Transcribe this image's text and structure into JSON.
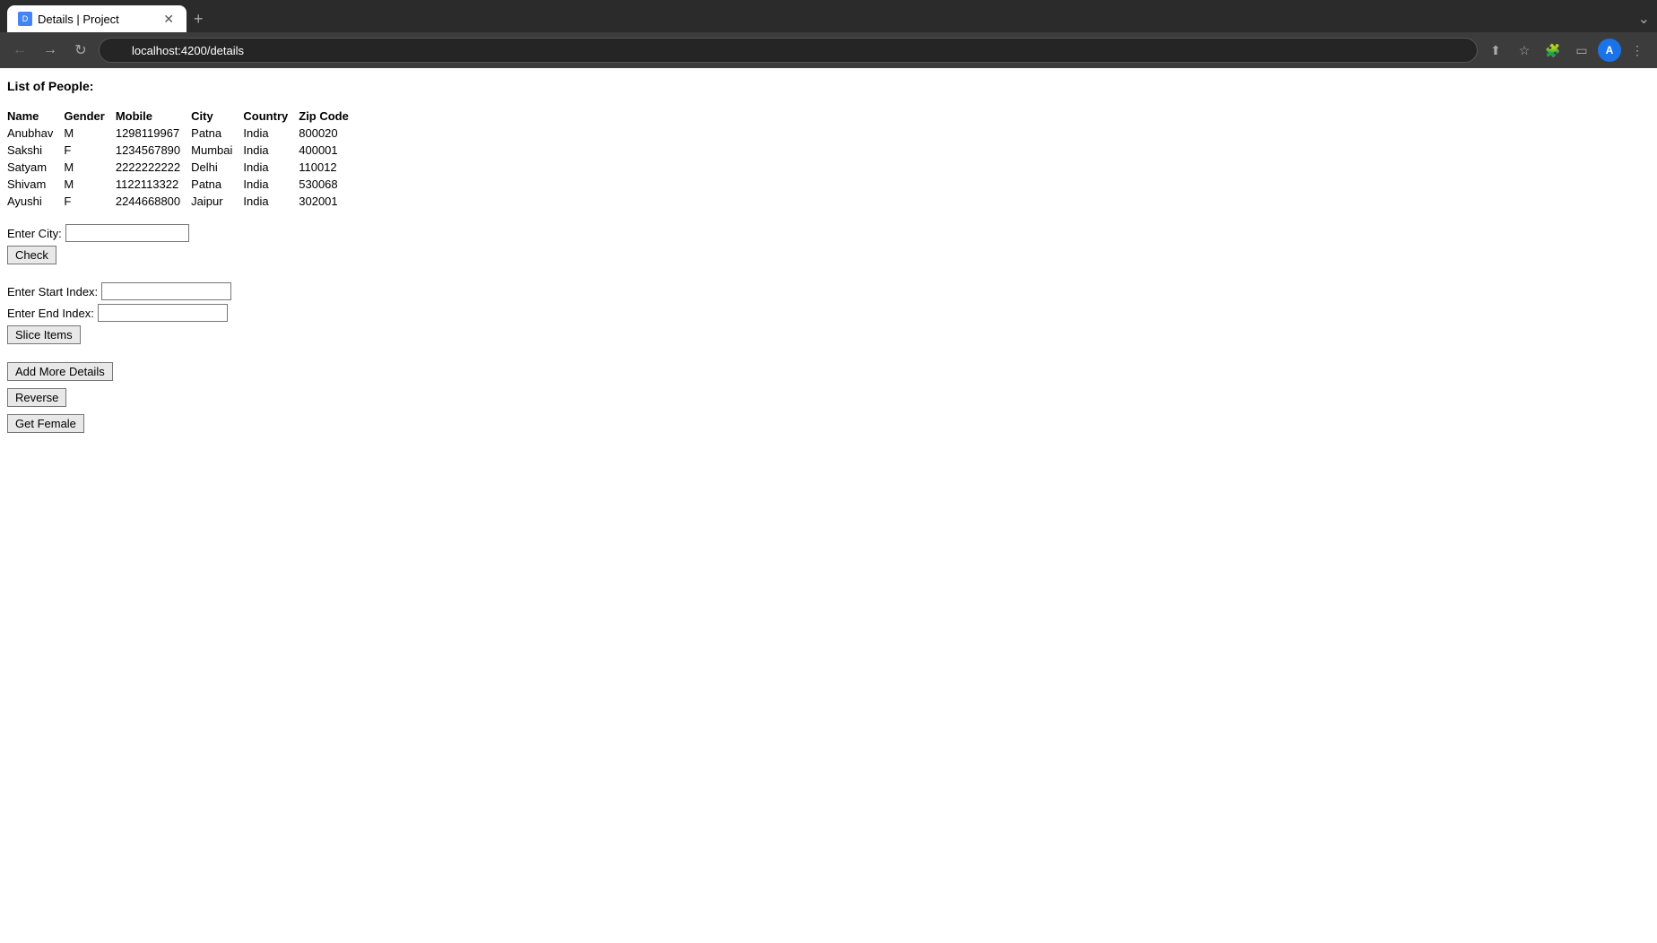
{
  "browser": {
    "tab_title": "Details | Project",
    "tab_favicon": "D",
    "new_tab_label": "+",
    "url": "localhost:4200/details",
    "nav": {
      "back": "←",
      "forward": "→",
      "refresh": "↻"
    }
  },
  "page": {
    "title": "List of People:",
    "table": {
      "headers": [
        "Name",
        "Gender",
        "Mobile",
        "City",
        "Country",
        "Zip Code"
      ],
      "rows": [
        [
          "Anubhav",
          "M",
          "1298119967",
          "Patna",
          "India",
          "800020"
        ],
        [
          "Sakshi",
          "F",
          "1234567890",
          "Mumbai",
          "India",
          "400001"
        ],
        [
          "Satyam",
          "M",
          "2222222222",
          "Delhi",
          "India",
          "110012"
        ],
        [
          "Shivam",
          "M",
          "1122113322",
          "Patna",
          "India",
          "530068"
        ],
        [
          "Ayushi",
          "F",
          "2244668800",
          "Jaipur",
          "India",
          "302001"
        ]
      ]
    },
    "city_form": {
      "label": "Enter City:",
      "placeholder": "",
      "button_label": "Check"
    },
    "slice_form": {
      "start_label": "Enter Start Index:",
      "end_label": "Enter End Index:",
      "start_placeholder": "",
      "end_placeholder": "",
      "button_label": "Slice Items"
    },
    "add_button_label": "Add More Details",
    "reverse_button_label": "Reverse",
    "get_female_button_label": "Get Female"
  }
}
